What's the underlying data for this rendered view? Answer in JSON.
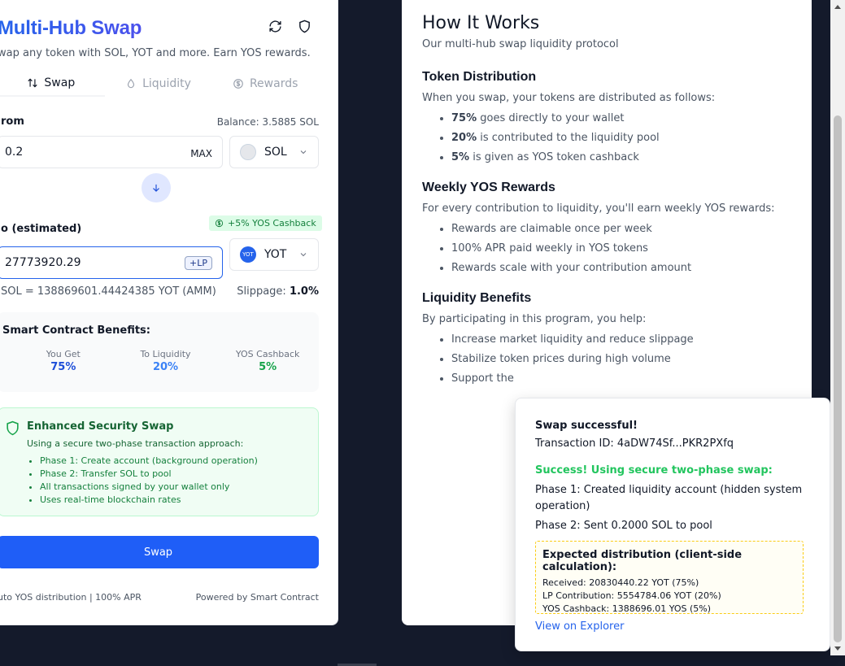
{
  "swap": {
    "title": "Multi-Hub Swap",
    "subtitle": "wap any token with SOL, YOT and more. Earn YOS rewards.",
    "icons": {
      "refresh": "refresh-icon",
      "shield": "shield-icon"
    },
    "tabs": [
      {
        "label": "Swap",
        "icon": "swap-arrows-icon",
        "active": true
      },
      {
        "label": "Liquidity",
        "icon": "droplet-icon",
        "active": false
      },
      {
        "label": "Rewards",
        "icon": "dollar-circle-icon",
        "active": false
      }
    ],
    "from": {
      "label": "rom",
      "balance": "Balance: 3.5885 SOL",
      "value": "0.2",
      "max_label": "MAX",
      "token": "SOL"
    },
    "to": {
      "label": "o (estimated)",
      "cashback_badge": "+5% YOS Cashback",
      "value": "27773920.29",
      "lp_badge": "+LP",
      "token": "YOT",
      "token_logo_text": "YOT"
    },
    "rate": {
      "text": "SOL = 138869601.44424385 YOT (AMM)",
      "slippage_label": "Slippage:",
      "slippage_value": "1.0%"
    },
    "benefits": {
      "title": "Smart Contract Benefits:",
      "items": [
        {
          "label": "You Get",
          "value": "75%",
          "color": "#1d4ed8"
        },
        {
          "label": "To Liquidity",
          "value": "20%",
          "color": "#3b82f6"
        },
        {
          "label": "YOS Cashback",
          "value": "5%",
          "color": "#16a34a"
        }
      ]
    },
    "security": {
      "title": "Enhanced Security Swap",
      "desc": "Using a secure two-phase transaction approach:",
      "items": [
        "Phase 1: Create account (background operation)",
        "Phase 2: Transfer SOL to pool",
        "All transactions signed by your wallet only",
        "Uses real-time blockchain rates"
      ]
    },
    "button_label": "Swap",
    "footer_left": "uto YOS distribution | 100% APR",
    "footer_right": "Powered by Smart Contract"
  },
  "how": {
    "title": "How It Works",
    "subtitle": "Our multi-hub swap liquidity protocol",
    "distribution": {
      "heading": "Token Distribution",
      "intro": "When you swap, your tokens are distributed as follows:",
      "items": [
        {
          "bold": "75%",
          "rest": " goes directly to your wallet"
        },
        {
          "bold": "20%",
          "rest": " is contributed to the liquidity pool"
        },
        {
          "bold": "5%",
          "rest": " is given as YOS token cashback"
        }
      ]
    },
    "rewards": {
      "heading": "Weekly YOS Rewards",
      "intro": "For every contribution to liquidity, you'll earn weekly YOS rewards:",
      "items": [
        "Rewards are claimable once per week",
        "100% APR paid weekly in YOS tokens",
        "Rewards scale with your contribution amount"
      ]
    },
    "benefits": {
      "heading": "Liquidity Benefits",
      "intro": "By participating in this program, you help:",
      "items": [
        "Increase market liquidity and reduce slippage",
        "Stabilize token prices during high volume",
        "Support the"
      ]
    }
  },
  "toast": {
    "title": "Swap successful!",
    "tx": "Transaction ID: 4aDW74Sf...PKR2PXfq",
    "success": "Success! Using secure two-phase swap:",
    "phase1": "Phase 1: Created liquidity account (hidden system operation)",
    "phase2": "Phase 2: Sent 0.2000 SOL to pool",
    "dist_title": "Expected distribution (client-side calculation):",
    "dist_received": "Received: 20830440.22 YOT (75%)",
    "dist_lp": "LP Contribution: 5554784.06 YOT (20%)",
    "dist_yos": "YOS Cashback: 1388696.01 YOS (5%)",
    "link": "View on Explorer"
  },
  "colors": {
    "page_bg": "#141a2b",
    "accent": "#1f5ef7",
    "success": "#22c55e"
  }
}
